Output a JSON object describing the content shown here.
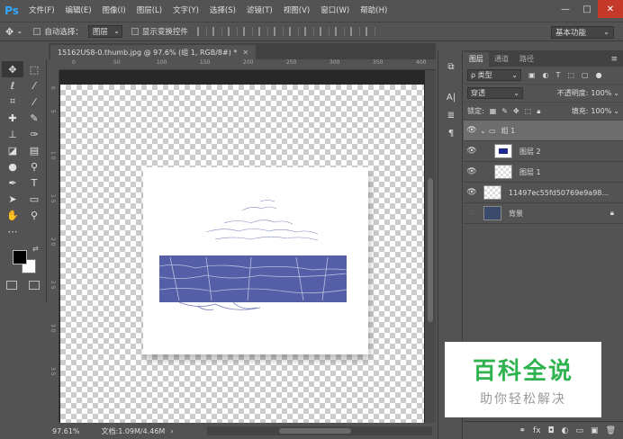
{
  "app": {
    "logo": "Ps"
  },
  "menu": [
    "文件(F)",
    "编辑(E)",
    "图像(I)",
    "图层(L)",
    "文字(Y)",
    "选择(S)",
    "滤镜(T)",
    "视图(V)",
    "窗口(W)",
    "帮助(H)"
  ],
  "window_controls": {
    "minimize": "—",
    "maximize": "□",
    "close": "✕"
  },
  "options": {
    "move_tool_icon": "✥",
    "auto_select_label": "自动选择：",
    "auto_select_target": "图层",
    "show_transform_label": "显示变换控件",
    "workspace": "基本功能"
  },
  "document": {
    "tab_title": "15162US8-0.thumb.jpg @ 97.6% (组 1, RGB/8#) *",
    "zoom": "97.61%",
    "doc_info": "文档:1.09M/4.46M"
  },
  "rulers": {
    "top": [
      "0",
      "50",
      "100",
      "150",
      "200",
      "250",
      "300",
      "350",
      "400"
    ],
    "left": [
      "0",
      "5",
      "1 0",
      "1 5",
      "2 0",
      "2 5",
      "3 0",
      "3 5"
    ]
  },
  "colors": {
    "foreground": "#000000",
    "background": "#ffffff",
    "sketch": "#1b2a8a"
  },
  "layers_panel": {
    "tabs": [
      "图层",
      "通道",
      "路径"
    ],
    "filter_kind": "ρ 类型",
    "blend_mode": "穿透",
    "opacity_label": "不透明度:",
    "opacity_value": "100%",
    "lock_label": "锁定:",
    "fill_label": "填充:",
    "fill_value": "100%",
    "layers": [
      {
        "name": "组 1",
        "type": "group",
        "visible": true
      },
      {
        "name": "图层 2",
        "type": "layer",
        "visible": true
      },
      {
        "name": "图层 1",
        "type": "layer",
        "visible": true
      },
      {
        "name": "11497ec55fd50769e9a98...",
        "type": "smart",
        "visible": true
      },
      {
        "name": "背景",
        "type": "background",
        "visible": false
      }
    ]
  },
  "watermark": {
    "title": "百科全说",
    "subtitle": "助你轻松解决"
  }
}
